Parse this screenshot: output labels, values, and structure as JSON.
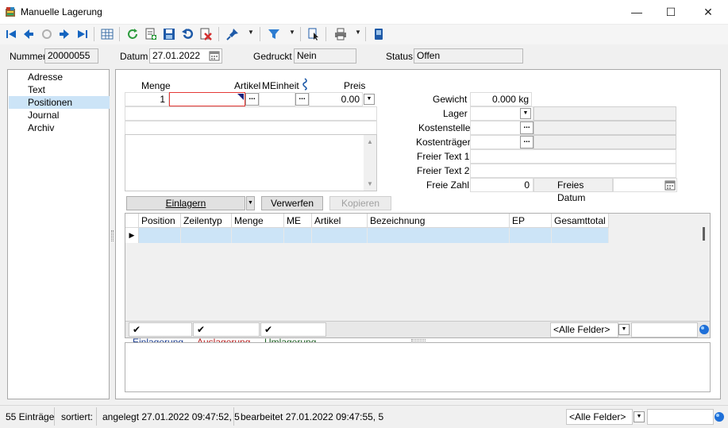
{
  "window": {
    "title": "Manuelle Lagerung"
  },
  "toolbar": {
    "icons": [
      "first-record-icon",
      "previous-record-icon",
      "refresh-disabled-icon",
      "next-record-icon",
      "last-record-icon",
      "table-view-icon",
      "reload-icon",
      "new-record-icon",
      "save-icon",
      "undo-icon",
      "delete-icon",
      "pin-icon",
      "filter-icon",
      "document-select-icon",
      "print-icon",
      "device-icon"
    ]
  },
  "header": {
    "nummer_label": "Nummer",
    "nummer_value": "20000055",
    "datum_label": "Datum",
    "datum_value": "27.01.2022",
    "gedruckt_label": "Gedruckt",
    "gedruckt_value": "Nein",
    "status_label": "Status",
    "status_value": "Offen"
  },
  "nav": {
    "items": [
      {
        "label": "Adresse"
      },
      {
        "label": "Text"
      },
      {
        "label": "Positionen"
      },
      {
        "label": "Journal"
      },
      {
        "label": "Archiv"
      }
    ],
    "selected": "Positionen"
  },
  "entry": {
    "menge_label": "Menge",
    "artikel_label": "Artikel",
    "meinheit_label": "MEinheit",
    "preis_label": "Preis",
    "menge_value": "1",
    "preis_value": "0.00"
  },
  "details": {
    "gewicht_label": "Gewicht",
    "gewicht_value": "0.000",
    "gewicht_unit": "kg",
    "lager_label": "Lager",
    "kostenstelle_label": "Kostenstelle",
    "kostentraeger_label": "Kostenträger",
    "freier_text1_label": "Freier Text 1",
    "freier_text2_label": "Freier Text 2",
    "freie_zahl_label": "Freie Zahl",
    "freie_zahl_value": "0",
    "freies_datum_label": "Freies Datum"
  },
  "actions": {
    "einlagern": "Einlagern",
    "verwerfen": "Verwerfen",
    "kopieren": "Kopieren"
  },
  "grid": {
    "columns": [
      "Position",
      "Zeilentyp",
      "Menge",
      "ME",
      "Artikel",
      "Bezeichnung",
      "EP",
      "Gesamttotal"
    ]
  },
  "filters": {
    "einlagerung": "Einlagerung",
    "auslagerung": "Auslagerung",
    "umlagerung": "Umlagerung",
    "alle_felder": "<Alle Felder>"
  },
  "statusbar": {
    "count": "55 Einträge",
    "sorted": "sortiert:",
    "created": "angelegt 27.01.2022 09:47:52,  5",
    "edited": "bearbeitet 27.01.2022 09:47:55,  5",
    "alle_felder": "<Alle Felder>"
  }
}
